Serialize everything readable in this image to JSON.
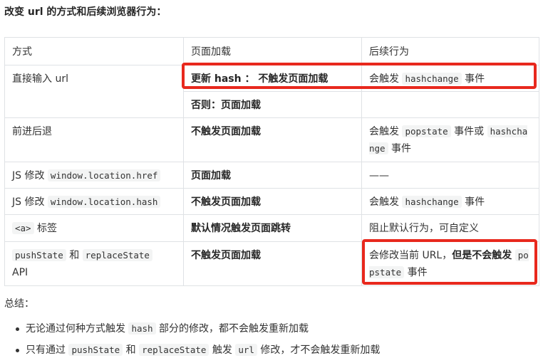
{
  "heading": "改变 url 的方式和后续浏览器行为：",
  "table": {
    "headers": [
      "方式",
      "页面加载",
      "后续行为"
    ],
    "rows": [
      {
        "method": "直接输入 url",
        "load": "更新 hash ： 不触发页面加载",
        "behavior_pre": "会触发",
        "behavior_code": "hashchange",
        "behavior_post": "事件"
      },
      {
        "load": "否则：页面加载"
      },
      {
        "method": "前进后退",
        "load": "不触发页面加载",
        "behavior_pre": "会触发",
        "behavior_code1": "popstate",
        "behavior_mid": "事件或",
        "behavior_code2": "hashchange",
        "behavior_post": "事件"
      },
      {
        "method_pre": "JS 修改",
        "method_code": "window.location.href",
        "load": "页面加载",
        "behavior": "——"
      },
      {
        "method_pre": "JS 修改",
        "method_code": "window.location.hash",
        "load": "不触发页面加载",
        "behavior_pre": "会触发",
        "behavior_code": "hashchange",
        "behavior_post": "事件"
      },
      {
        "method_code": "<a>",
        "method_post": "标签",
        "load": "默认情况触发页面跳转",
        "behavior": "阻止默认行为，可自定义"
      },
      {
        "method_code1": "pushState",
        "method_mid": "和",
        "method_code2": "replaceState",
        "method_post": "API",
        "load": "不触发页面加载",
        "behavior_pre": "会修改当前 URL，",
        "behavior_bold": "但是不会触发",
        "behavior_code": "popstate",
        "behavior_post": "事件"
      }
    ]
  },
  "summary": "总结：",
  "bullets": [
    {
      "pre": "无论通过何种方式触发",
      "code": "hash",
      "post": "部分的修改，都不会触发重新加载"
    },
    {
      "pre": "只有通过",
      "code1": "pushState",
      "mid": "和",
      "code2": "replaceState",
      "mid2": "触发",
      "code3": "url",
      "post": "修改，才不会触发重新加载"
    }
  ],
  "highlight_color": "#e8281d"
}
